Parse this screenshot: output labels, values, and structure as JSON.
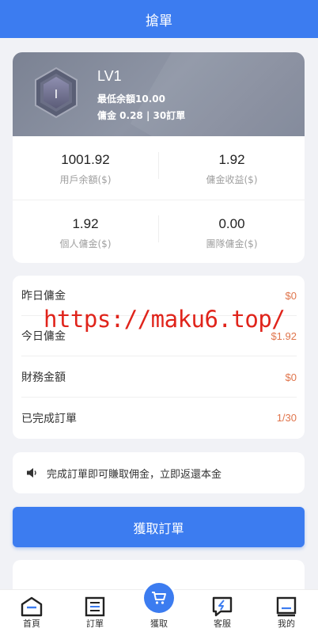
{
  "header": {
    "title": "搶單"
  },
  "level": {
    "badge_letter": "I",
    "title": "LV1",
    "min_balance": "最低余額10.00",
    "commission": "傭金 0.28 | 30訂單"
  },
  "stats": [
    {
      "value": "1001.92",
      "label": "用戶余額($)"
    },
    {
      "value": "1.92",
      "label": "傭金收益($)"
    },
    {
      "value": "1.92",
      "label": "個人傭金($)"
    },
    {
      "value": "0.00",
      "label": "團隊傭金($)"
    }
  ],
  "summary": [
    {
      "label": "昨日傭金",
      "value": "$0"
    },
    {
      "label": "今日傭金",
      "value": "$1.92"
    },
    {
      "label": "財務金額",
      "value": "$0"
    },
    {
      "label": "已完成訂單",
      "value": "1/30"
    }
  ],
  "notice": {
    "text": "完成訂單即可賺取佣金，立即返還本金",
    "icon": "speaker-icon"
  },
  "action": {
    "label": "獲取訂單"
  },
  "tabbar": [
    {
      "label": "首頁",
      "icon": "home-icon"
    },
    {
      "label": "訂單",
      "icon": "order-list-icon"
    },
    {
      "label": "獲取",
      "icon": "cart-icon"
    },
    {
      "label": "客服",
      "icon": "support-icon"
    },
    {
      "label": "我的",
      "icon": "profile-icon"
    }
  ],
  "watermark": "https://maku6.top/",
  "colors": {
    "primary": "#3c7cf0",
    "accent_value": "#e0754c",
    "watermark": "#e0241b"
  }
}
